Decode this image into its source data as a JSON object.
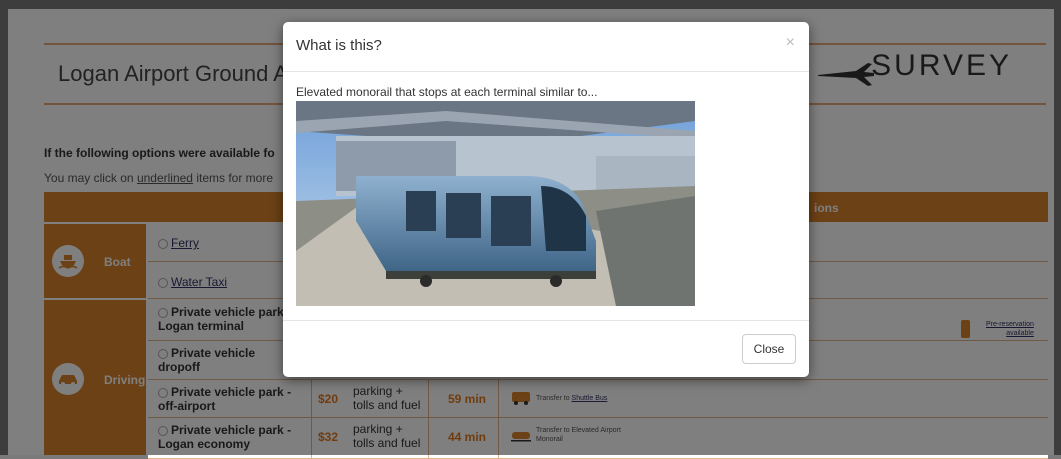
{
  "header": {
    "title_visible": "Logan Airport Ground A",
    "brand": "SURVEY"
  },
  "intro": {
    "question_visible": "If the following options were available fo",
    "hint_prefix": "You may click on ",
    "hint_link": "underlined",
    "hint_suffix": " items for more"
  },
  "table": {
    "header_partial": "ions",
    "categories": [
      {
        "label": "Boat",
        "icon": "boat-icon"
      },
      {
        "label": "Driving",
        "icon": "car-icon"
      }
    ],
    "rows": [
      {
        "option": "Ferry"
      },
      {
        "option": "Water Taxi"
      },
      {
        "option_line1": "Private vehicle park",
        "option_line2": "Logan terminal",
        "note_line1": "Pre-reservation",
        "note_line2": "available"
      },
      {
        "option_line1": "Private vehicle",
        "option_line2": "dropoff"
      },
      {
        "option_line1": "Private vehicle park -",
        "option_line2": "off-airport",
        "cost": "$20",
        "cost_line1": "parking +",
        "cost_line2": "tolls and fuel",
        "time": "59 min",
        "transfer_prefix": "Transfer to ",
        "transfer_link": "Shuttle Bus"
      },
      {
        "option_line1": "Private vehicle park -",
        "option_line2": "Logan economy",
        "cost": "$32",
        "cost_line1": "parking +",
        "cost_line2": "tolls and fuel",
        "time": "44 min",
        "transfer_line1": "Transfer to Elevated Airport",
        "transfer_line2": "Monorail"
      }
    ]
  },
  "modal": {
    "title": "What is this?",
    "close_symbol": "×",
    "description": "Elevated monorail that stops at each terminal similar to...",
    "close_label": "Close"
  },
  "colors": {
    "accent": "#d9822b",
    "overlay": "rgba(0,0,0,0.5)"
  }
}
